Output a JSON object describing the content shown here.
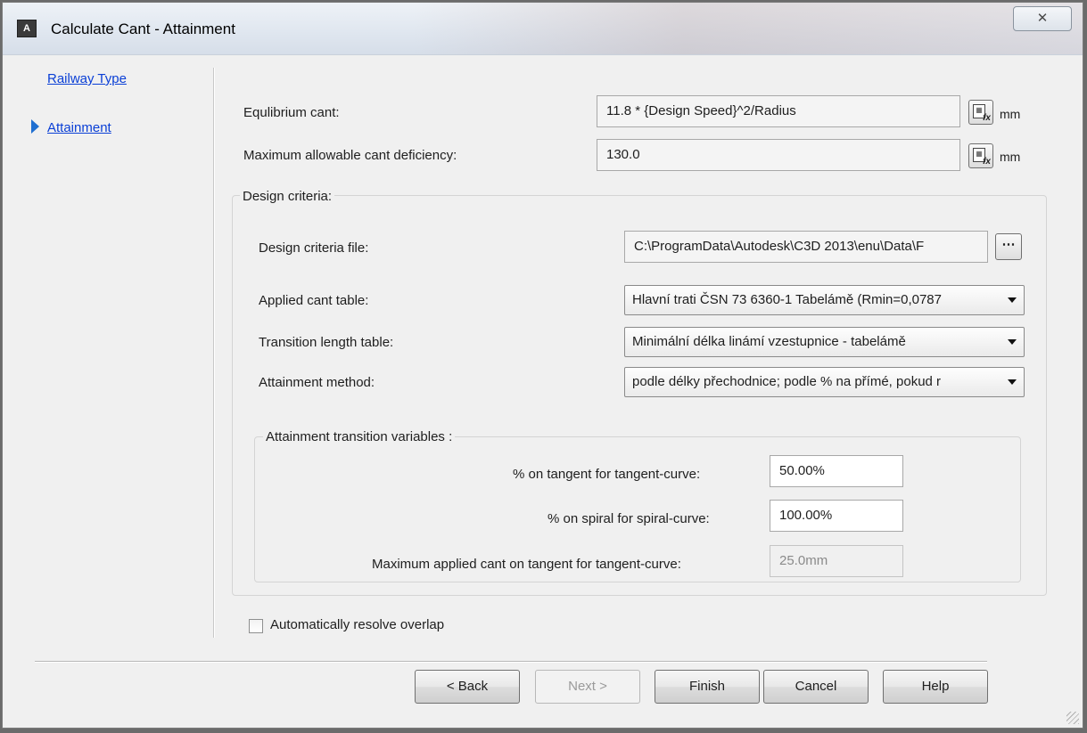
{
  "window": {
    "title": "Calculate Cant - Attainment",
    "close_label": "✕"
  },
  "nav": {
    "items": [
      {
        "label": "Railway Type",
        "active": false
      },
      {
        "label": "Attainment",
        "active": true
      }
    ]
  },
  "cant": {
    "equilibrium_label": "Equlibrium cant:",
    "equilibrium_value": "11.8 * {Design Speed}^2/Radius",
    "equilibrium_unit": "mm",
    "deficiency_label": "Maximum allowable cant deficiency:",
    "deficiency_value": "130.0",
    "deficiency_unit": "mm"
  },
  "design_criteria": {
    "group_title": "Design criteria:",
    "file_label": "Design criteria file:",
    "file_value": "C:\\ProgramData\\Autodesk\\C3D 2013\\enu\\Data\\F",
    "browse_label": "⋯",
    "applied_cant_label": "Applied cant table:",
    "applied_cant_value": "Hlavní trati ČSN 73 6360-1 Tabelámě (Rmin=0,0787",
    "transition_length_label": "Transition length table:",
    "transition_length_value": "Minimální délka linámí vzestupnice - tabelámě",
    "attainment_method_label": "Attainment method:",
    "attainment_method_value": "podle délky přechodnice; podle % na přímé, pokud r"
  },
  "transition_vars": {
    "group_title": "Attainment transition variables :",
    "tangent_curve_label": "% on tangent for tangent-curve:",
    "tangent_curve_value": "50.00%",
    "spiral_curve_label": "% on spiral for spiral-curve:",
    "spiral_curve_value": "100.00%",
    "max_applied_label": "Maximum applied cant on tangent for tangent-curve:",
    "max_applied_value": "25.0mm"
  },
  "overlap": {
    "label": "Automatically resolve overlap",
    "checked": false
  },
  "buttons": {
    "back": "< Back",
    "next": "Next >",
    "finish": "Finish",
    "cancel": "Cancel",
    "help": "Help"
  }
}
